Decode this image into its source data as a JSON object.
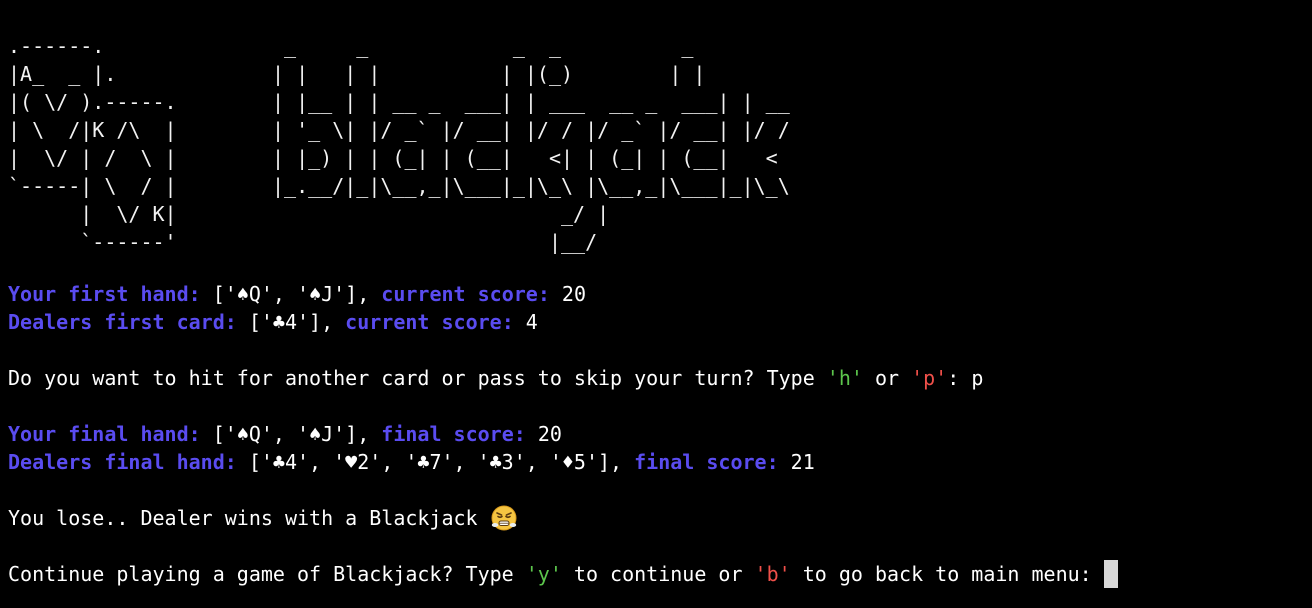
{
  "banner": {
    "card_art": ".------.\n|A_  _ |.\n|( \\/ ).-----.\n| \\  /|K /\\  |\n|  \\/ | /  \\ |\n`-----| \\  / |\n      |  \\/ K|\n      `------'",
    "title_art": " _     _            _  _          _\n| |   | |          | |(_)        | |\n| |__ | | __ _  ___| | ___  __ _  ___| | __\n| '_ \\| |/ _` |/ __| |/ / |/ _` |/ __| |/ /\n| |_) | | (_| | (__|   <| | (_| | (__|   <\n|_.__/|_|\\__,_|\\___|_|\\_\\ |\\__,_|\\___|_|\\_\\\n                        _/ |\n                       |__/"
  },
  "player_first": {
    "label": "Your first hand:",
    "hand": " ['♠Q', '♠J'], ",
    "score_label": "current score:",
    "score": " 20"
  },
  "dealer_first": {
    "label": "Dealers first card:",
    "hand": " ['♣4'], ",
    "score_label": "current score:",
    "score": " 4"
  },
  "hit_prompt": {
    "text": "Do you want to hit for another card or pass to skip your turn? Type ",
    "option_hit": "'h'",
    "or": " or ",
    "option_pass": "'p'",
    "suffix": ": ",
    "input": "p"
  },
  "player_final": {
    "label": "Your final hand:",
    "hand": " ['♠Q', '♠J'], ",
    "score_label": "final score:",
    "score": " 20"
  },
  "dealer_final": {
    "label": "Dealers final hand:",
    "hand": " ['♣4', '♥2', '♣7', '♣3', '♦5'], ",
    "score_label": "final score:",
    "score": " 21"
  },
  "result": {
    "text": "You lose.. Dealer wins with a Blackjack ",
    "emoji": "angry-face-steam-emoji-icon"
  },
  "continue_prompt": {
    "text": "Continue playing a game of Blackjack? Type ",
    "option_continue": "'y'",
    "middle": " to continue or ",
    "option_back": "'b'",
    "suffix": " to go back to main menu: "
  },
  "colors": {
    "background": "#000000",
    "label_blue": "#5a4cf0",
    "option_green": "#5cc64c",
    "option_red": "#f0504a"
  }
}
